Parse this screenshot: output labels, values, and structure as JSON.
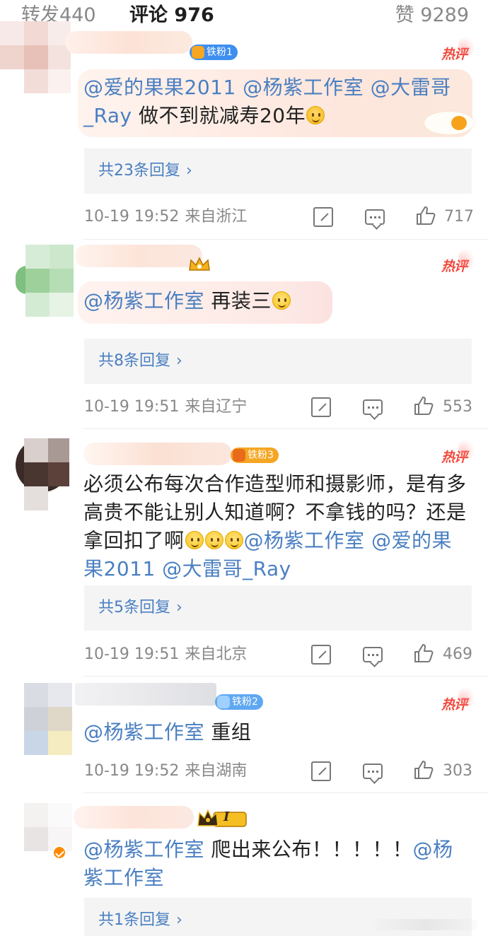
{
  "tabs": {
    "repost": {
      "label": "转发",
      "count": "440"
    },
    "comment": {
      "label": "评论",
      "count": "976"
    },
    "like": {
      "label": "赞",
      "count": "9289"
    }
  },
  "hot_label": "热评",
  "colors": {
    "mention": "#4a7fc1",
    "hot": "#f04a3d",
    "meta": "#888888"
  },
  "comments": [
    {
      "badge": "铁粉1",
      "content": {
        "m1": "@爱的果果2011",
        "m2": "@杨紫工作室",
        "m3": "@大雷哥_Ray",
        "text": "做不到就减寿20年",
        "emoji": "hug-emoji"
      },
      "replies": "共23条回复",
      "time": "10-19 19:52",
      "source": "来自浙江",
      "likes": "717"
    },
    {
      "badge_icon": "crown-icon",
      "content": {
        "m1": "@杨紫工作室",
        "text": "再装三",
        "emoji": "smile-emoji"
      },
      "replies": "共8条回复",
      "time": "10-19 19:51",
      "source": "来自辽宁",
      "likes": "553"
    },
    {
      "badge": "铁粉3",
      "content": {
        "line1": "必须公布每次合作造型师和摄影师，是有多",
        "line2": "高贵不能让别人知道啊？不拿钱的吗？还是",
        "line3_text": "拿回扣了啊",
        "m1": "@杨紫工作室",
        "m2": "@爱的果",
        "m3": "果2011",
        "m4": "@大雷哥_Ray"
      },
      "replies": "共5条回复",
      "time": "10-19 19:51",
      "source": "来自北京",
      "likes": "469"
    },
    {
      "badge": "铁粉2",
      "content": {
        "m1": "@杨紫工作室",
        "text": "重组"
      },
      "time": "10-19 19:52",
      "source": "来自湖南",
      "likes": "303"
    },
    {
      "badge_icon": "crown-level-icon",
      "badge_level": "I",
      "content": {
        "m1": "@杨紫工作室",
        "text": "爬出来公布！！！！！",
        "m2": "@杨",
        "m3": "紫工作室"
      },
      "replies": "共1条回复",
      "chevron": "›"
    }
  ],
  "chevron": "›"
}
